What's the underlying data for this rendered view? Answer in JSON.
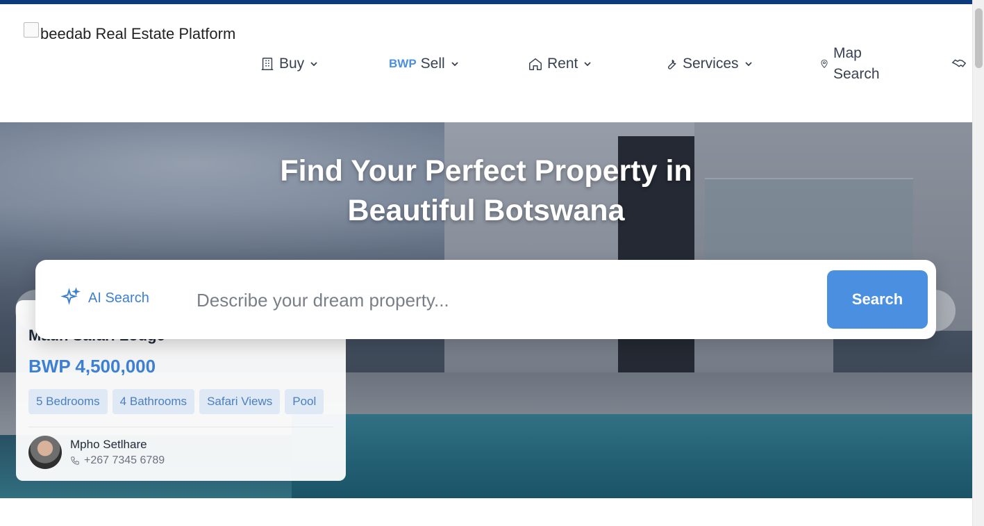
{
  "logo": {
    "alt": "beedab Real Estate Platform"
  },
  "nav": {
    "buy": "Buy",
    "sell_tag": "BWP",
    "sell": "Sell",
    "rent": "Rent",
    "services": "Services",
    "map_search_line1": "Map",
    "map_search_line2": "Search"
  },
  "hero": {
    "title_line1": "Find Your Perfect Property in",
    "title_line2": "Beautiful Botswana"
  },
  "search": {
    "ai_label": "AI Search",
    "placeholder": "Describe your dream property...",
    "button": "Search"
  },
  "featured": {
    "title": "Maun Safari Lodge",
    "price": "BWP 4,500,000",
    "tags": [
      "5 Bedrooms",
      "4 Bathrooms",
      "Safari Views",
      "Pool"
    ],
    "agent_name": "Mpho Setlhare",
    "agent_phone": "+267 7345 6789"
  },
  "colors": {
    "accent": "#4a8fe0",
    "top_strip": "#0b3a7e",
    "price": "#3d7fd1"
  }
}
